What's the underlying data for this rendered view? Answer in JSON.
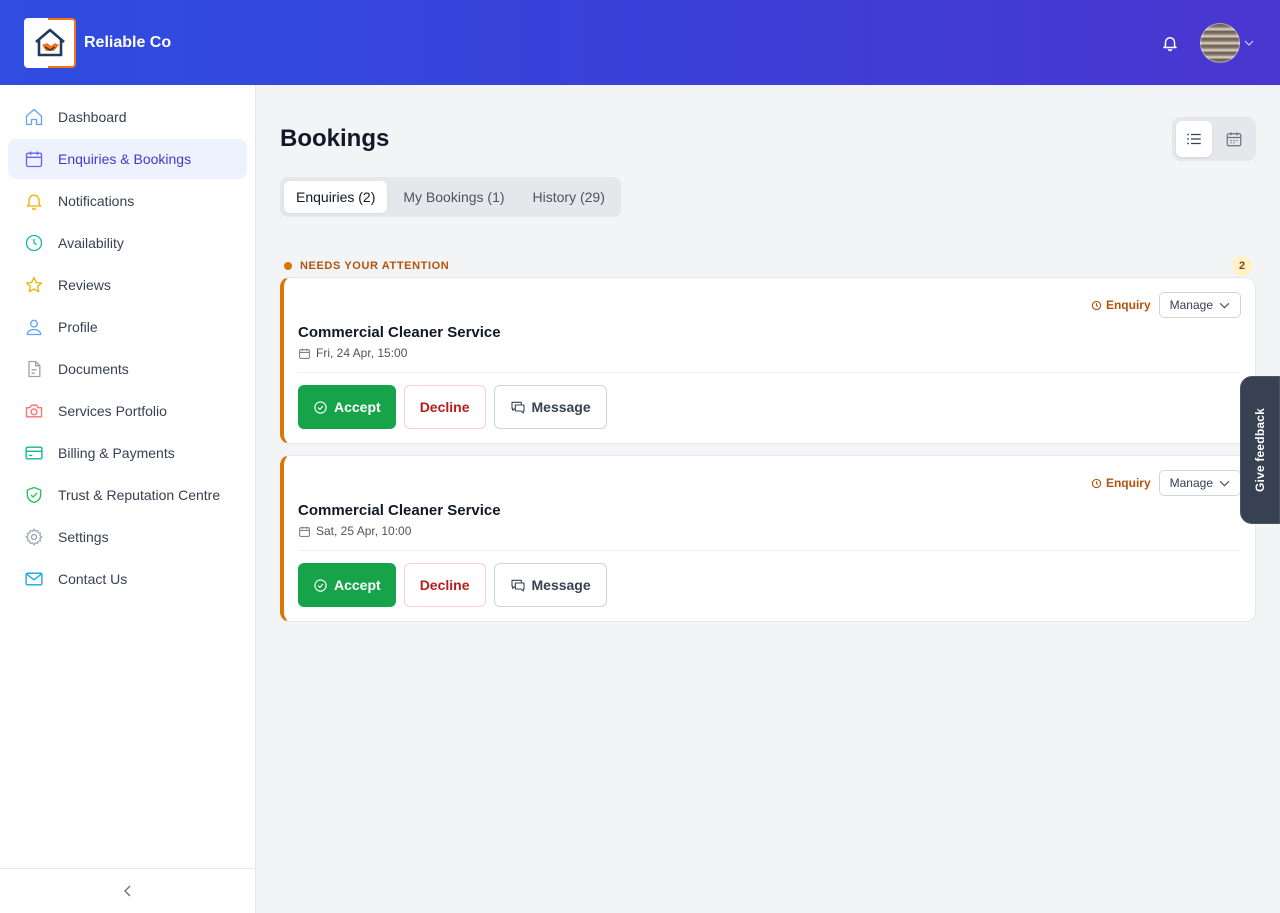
{
  "header": {
    "brand_name": "Reliable Co"
  },
  "sidebar": {
    "items": [
      {
        "label": "Dashboard",
        "icon": "home-icon",
        "color": "#60a5fa"
      },
      {
        "label": "Enquiries & Bookings",
        "icon": "calendar-icon",
        "color": "#6366f1",
        "active": true
      },
      {
        "label": "Notifications",
        "icon": "bell-icon",
        "color": "#eab308"
      },
      {
        "label": "Availability",
        "icon": "clock-icon",
        "color": "#14b8a6"
      },
      {
        "label": "Reviews",
        "icon": "star-icon",
        "color": "#eab308"
      },
      {
        "label": "Profile",
        "icon": "user-icon",
        "color": "#60a5fa"
      },
      {
        "label": "Documents",
        "icon": "document-icon",
        "color": "#9ca3af"
      },
      {
        "label": "Services Portfolio",
        "icon": "camera-icon",
        "color": "#f87171"
      },
      {
        "label": "Billing & Payments",
        "icon": "credit-card-icon",
        "color": "#10b981"
      },
      {
        "label": "Trust & Reputation Centre",
        "icon": "shield-check-icon",
        "color": "#22c55e"
      },
      {
        "label": "Settings",
        "icon": "gear-icon",
        "color": "#9ca3af"
      },
      {
        "label": "Contact Us",
        "icon": "mail-icon",
        "color": "#0ea5e9"
      }
    ]
  },
  "main": {
    "title": "Bookings",
    "tabs": [
      {
        "label": "Enquiries (2)",
        "active": true
      },
      {
        "label": "My Bookings (1)"
      },
      {
        "label": "History (29)"
      }
    ],
    "section": {
      "label": "NEEDS YOUR ATTENTION",
      "count": "2"
    },
    "cards": [
      {
        "status": "Enquiry",
        "manage_label": "Manage",
        "title": "Commercial Cleaner Service",
        "date": "Fri, 24 Apr, 15:00",
        "accept_label": "Accept",
        "decline_label": "Decline",
        "message_label": "Message"
      },
      {
        "status": "Enquiry",
        "manage_label": "Manage",
        "title": "Commercial Cleaner Service",
        "date": "Sat, 25 Apr, 10:00",
        "accept_label": "Accept",
        "decline_label": "Decline",
        "message_label": "Message"
      }
    ]
  },
  "feedback": {
    "label": "Give feedback"
  },
  "colors": {
    "accent": "#4338ca",
    "attention": "#d97706",
    "accept": "#16a34a",
    "decline": "#b91c1c"
  }
}
